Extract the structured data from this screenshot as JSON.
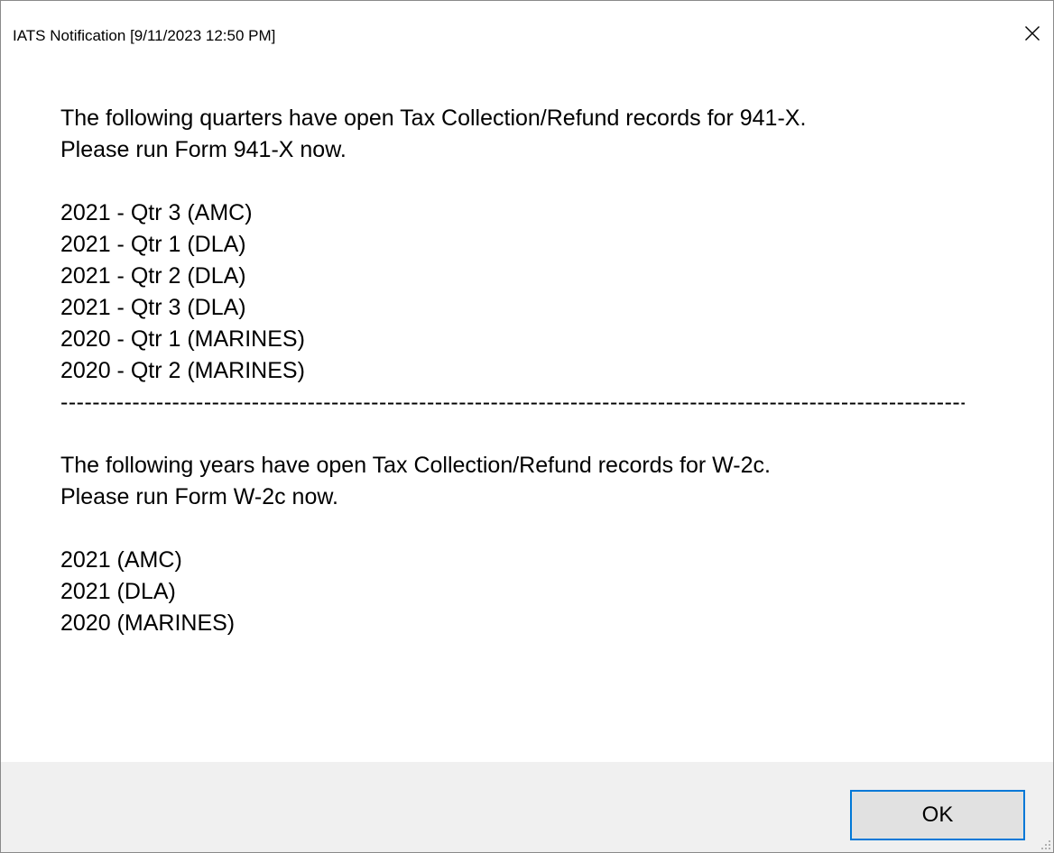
{
  "window": {
    "title": "IATS Notification [9/11/2023 12:50 PM]",
    "close_icon": "close-icon"
  },
  "message": {
    "section_941x": {
      "line1": "The following quarters have open Tax Collection/Refund records for 941-X.",
      "line2": "Please run Form 941-X now.",
      "items": [
        "2021 - Qtr 3 (AMC)",
        "2021 - Qtr 1 (DLA)",
        "2021 - Qtr 2 (DLA)",
        "2021 - Qtr 3 (DLA)",
        "2020 - Qtr 1 (MARINES)",
        "2020 - Qtr 2 (MARINES)"
      ]
    },
    "separator": "--------------------------------------------------------------------------------------------------------------------------------",
    "section_w2c": {
      "line1": "The following years have open Tax Collection/Refund records for W-2c.",
      "line2": "Please run Form W-2c now.",
      "items": [
        "2021 (AMC)",
        "2021 (DLA)",
        "2020 (MARINES)"
      ]
    }
  },
  "buttons": {
    "ok_label": "OK"
  },
  "colors": {
    "accent": "#0078d7",
    "footer_bg": "#f0f0f0",
    "button_bg": "#e1e1e1"
  }
}
